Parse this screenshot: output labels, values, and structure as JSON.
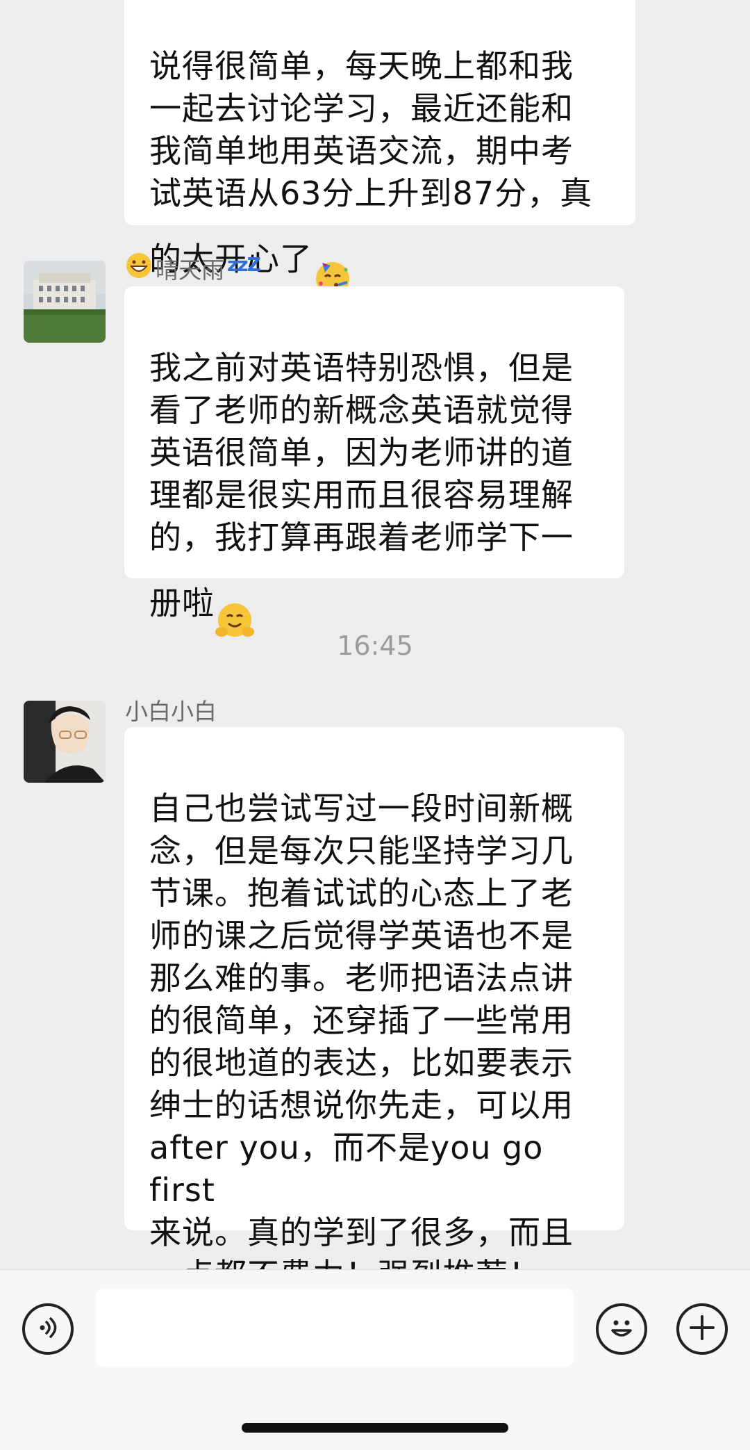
{
  "messages": [
    {
      "sender": "",
      "text": "说得很简单，每天晚上都和我\n一起去讨论学习，最近还能和\n我简单地用英语交流，期中考\n试英语从63分上升到87分，真\n的太开心了",
      "trailing_emoji": "party-face"
    },
    {
      "sender_prefix_emoji": "grinning-face",
      "sender": "晴天雨",
      "sender_suffix": "zzZ",
      "text": "我之前对英语特别恐惧，但是\n看了老师的新概念英语就觉得\n英语很简单，因为老师讲的道\n理都是很实用而且很容易理解\n的，我打算再跟着老师学下一\n册啦",
      "trailing_emoji": "hugging-face"
    },
    {
      "sender": "小白小白",
      "text": "自己也尝试写过一段时间新概\n念，但是每次只能坚持学习几\n节课。抱着试试的心态上了老\n师的课之后觉得学英语也不是\n那么难的事。老师把语法点讲\n的很简单，还穿插了一些常用\n的很地道的表达，比如要表示\n绅士的话想说你先走，可以用\nafter you，而不是you go first\n来说。真的学到了很多，而且\n一点都不费力！强烈推荐！"
    }
  ],
  "timestamp": "16:45",
  "input_bar": {
    "voice_icon": "voice-icon",
    "emoji_icon": "emoji-icon",
    "plus_icon": "plus-icon",
    "input_value": ""
  },
  "colors": {
    "background": "#ededed",
    "bubble": "#ffffff",
    "sender_name": "#6b6b6b",
    "timestamp": "#9b9b9b",
    "zzz": "#2f6fd6"
  }
}
